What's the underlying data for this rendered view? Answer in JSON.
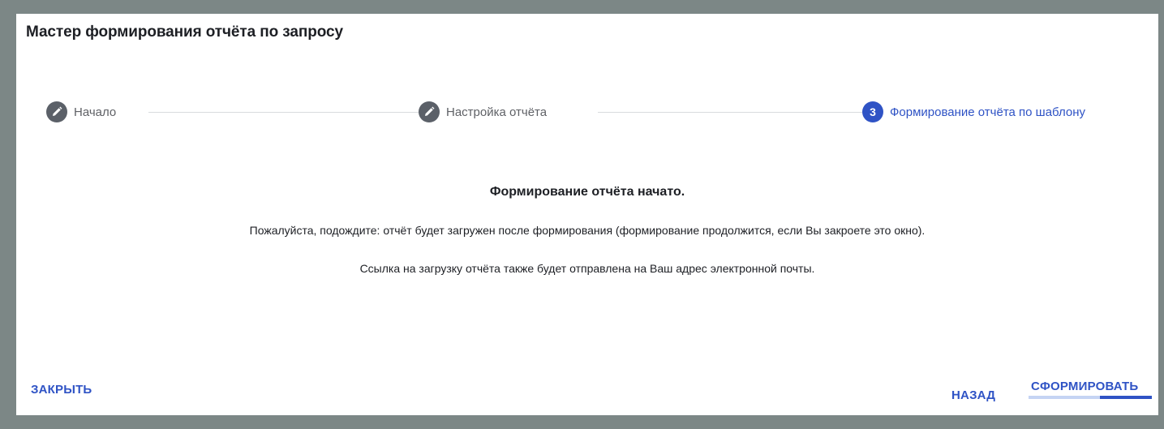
{
  "dialog": {
    "title": "Мастер формирования отчёта по запросу"
  },
  "stepper": {
    "steps": [
      {
        "label": "Начало",
        "state": "completed",
        "icon": "pencil-icon"
      },
      {
        "label": "Настройка отчёта",
        "state": "completed",
        "icon": "pencil-icon"
      },
      {
        "label": "Формирование отчёта по шаблону",
        "state": "active",
        "number": "3"
      }
    ]
  },
  "message": {
    "heading": "Формирование отчёта начато.",
    "line1": "Пожалуйста, подождите: отчёт будет загружен после формирования (формирование продолжится, если Вы закроете это окно).",
    "line2": "Ссылка на загрузку отчёта также будет отправлена на Ваш адрес электронной почты."
  },
  "actions": {
    "close_label": "ЗАКРЫТЬ",
    "back_label": "НАЗАД",
    "generate_label": "СФОРМИРОВАТЬ",
    "generate_progress": 0.42
  },
  "colors": {
    "backdrop": "#7c8786",
    "accent": "#2f53c5",
    "completed_step": "#5b6068",
    "progress_track": "#c5d4f4"
  }
}
